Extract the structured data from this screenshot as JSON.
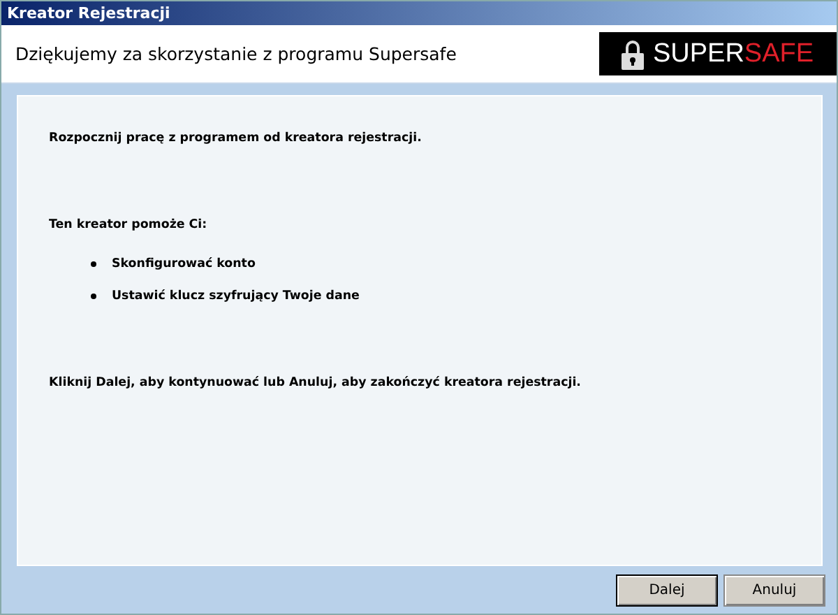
{
  "window": {
    "title": "Kreator Rejestracji"
  },
  "header": {
    "heading": "Dziękujemy za skorzystanie z programu Supersafe",
    "logo": {
      "part_1": "SUPER",
      "part_2": "SAFE"
    }
  },
  "content": {
    "intro": "Rozpocznij pracę z programem od kreatora rejestracji.",
    "list_heading": "Ten kreator pomoże Ci:",
    "items": [
      "Skonfigurować konto",
      "Ustawić klucz szyfrujący Twoje dane"
    ],
    "instruction": "Kliknij Dalej, aby kontynuować lub Anuluj, aby zakończyć kreatora rejestracji."
  },
  "buttons": [
    {
      "label": "Dalej",
      "default": true
    },
    {
      "label": "Anuluj",
      "default": false
    }
  ]
}
